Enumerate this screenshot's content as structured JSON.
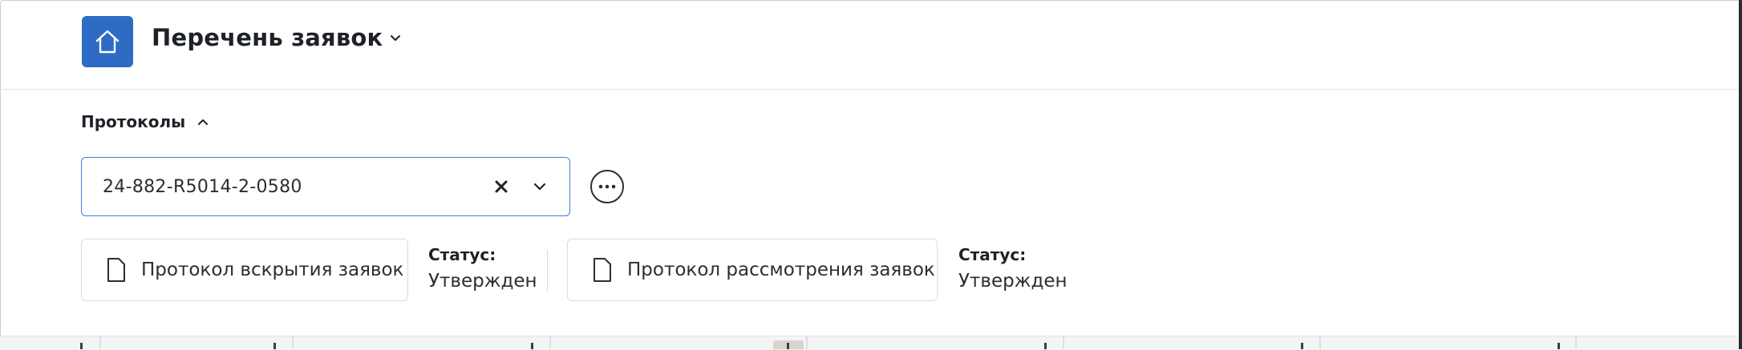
{
  "header": {
    "title": "Перечень заявок",
    "home_icon": "home-icon",
    "title_dropdown_icon": "chevron-down-icon"
  },
  "protocols": {
    "section_title": "Протоколы",
    "section_toggle_icon": "chevron-up-icon",
    "selected_protocol": "24-882-R5014-2-0580",
    "clear_icon": "close-icon",
    "dropdown_icon": "chevron-down-icon",
    "more_icon": "more-horizontal-icon",
    "documents": [
      {
        "label": "Протокол вскрытия заявок",
        "icon": "document-icon",
        "status_label": "Статус:",
        "status_value": "Утвержден"
      },
      {
        "label": "Протокол рассмотрения заявок",
        "icon": "document-icon",
        "status_label": "Статус:",
        "status_value": "Утвержден"
      }
    ]
  },
  "colors": {
    "accent": "#2d6bc4",
    "focus_border": "#3b82d6",
    "text": "#1e2228",
    "border": "#d9dce0"
  }
}
